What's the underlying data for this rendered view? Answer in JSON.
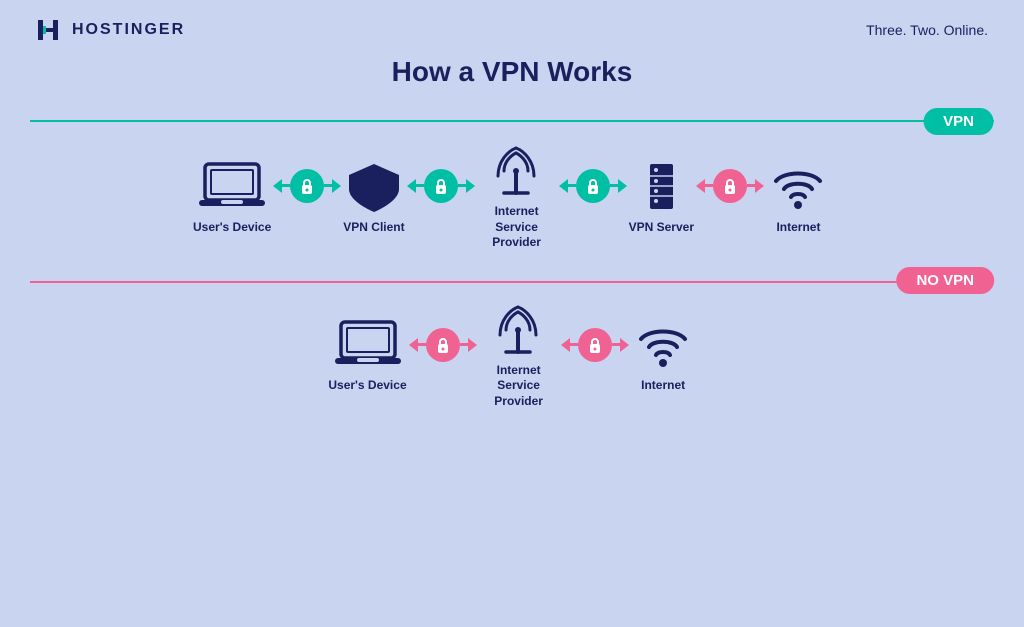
{
  "header": {
    "logo_text": "HOSTINGER",
    "tagline": "Three. Two. Online."
  },
  "main_title": "How a VPN Works",
  "vpn_section": {
    "badge": "VPN",
    "items": [
      {
        "label": "User's Device"
      },
      {
        "label": "VPN Client"
      },
      {
        "label": "Internet Service Provider"
      },
      {
        "label": "VPN Server"
      },
      {
        "label": "Internet"
      }
    ]
  },
  "novpn_section": {
    "badge": "NO VPN",
    "items": [
      {
        "label": "User's Device"
      },
      {
        "label": "Internet Service Provider"
      },
      {
        "label": "Internet"
      }
    ]
  },
  "colors": {
    "teal": "#00bfa5",
    "pink": "#f06292",
    "navy": "#1a1f5e",
    "bg": "#c8d4f0"
  }
}
